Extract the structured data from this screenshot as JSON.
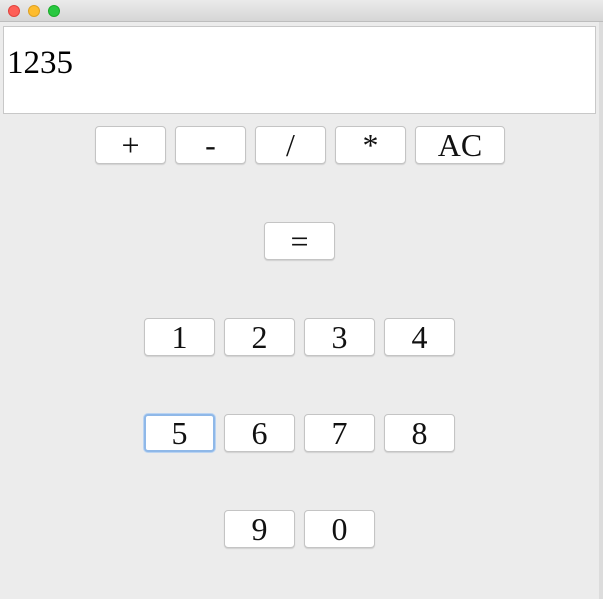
{
  "window": {
    "controls": {
      "close": "close-icon",
      "minimize": "minimize-icon",
      "maximize": "maximize-icon"
    }
  },
  "display": {
    "value": "1235"
  },
  "operators": {
    "add": "+",
    "subtract": "-",
    "divide": "/",
    "multiply": "*",
    "clear": "AC"
  },
  "equals": "=",
  "digits": {
    "d1": "1",
    "d2": "2",
    "d3": "3",
    "d4": "4",
    "d5": "5",
    "d6": "6",
    "d7": "7",
    "d8": "8",
    "d9": "9",
    "d0": "0"
  },
  "focus": {
    "button": "5",
    "ring_color": "#8fb8e8"
  }
}
